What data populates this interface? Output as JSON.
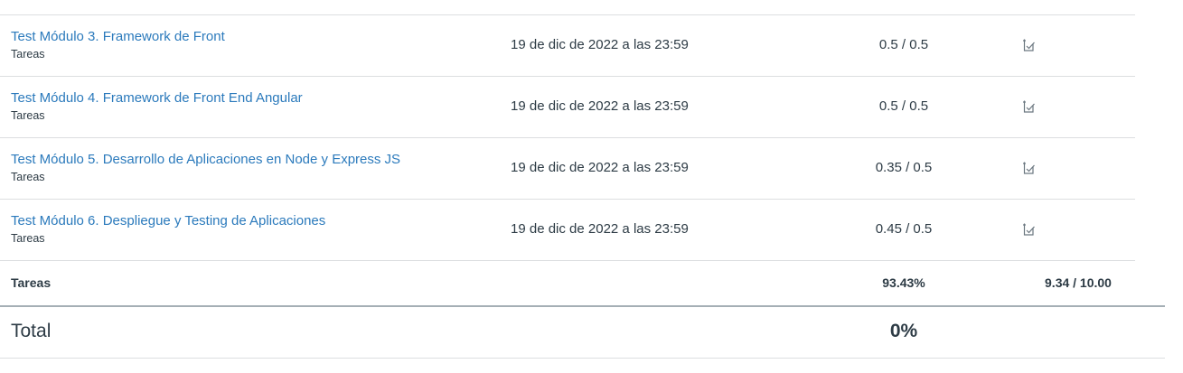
{
  "assignments": [
    {
      "title": "Test Módulo 3. Framework de Front",
      "context": "Tareas",
      "due": "19 de dic de 2022 a las 23:59",
      "score": "0.5 / 0.5",
      "icon": "submission-check-icon"
    },
    {
      "title": "Test Módulo 4. Framework de Front End Angular",
      "context": "Tareas",
      "due": "19 de dic de 2022 a las 23:59",
      "score": "0.5 / 0.5",
      "icon": "submission-check-icon"
    },
    {
      "title": "Test Módulo 5. Desarrollo de Aplicaciones en Node y Express JS",
      "context": "Tareas",
      "due": "19 de dic de 2022 a las 23:59",
      "score": "0.35 / 0.5",
      "icon": "submission-check-icon"
    },
    {
      "title": "Test Módulo 6. Despliegue y Testing de Aplicaciones",
      "context": "Tareas",
      "due": "19 de dic de 2022 a las 23:59",
      "score": "0.45 / 0.5",
      "icon": "submission-check-icon"
    }
  ],
  "group_total": {
    "label": "Tareas",
    "percent": "93.43%",
    "points": "9.34 / 10.00"
  },
  "total": {
    "label": "Total",
    "percent": "0%"
  },
  "colors": {
    "link": "#2b7abc",
    "text": "#2d3b45",
    "divider": "#dcdee0",
    "total_divider": "#a5afb5",
    "icon": "#6b7780"
  }
}
